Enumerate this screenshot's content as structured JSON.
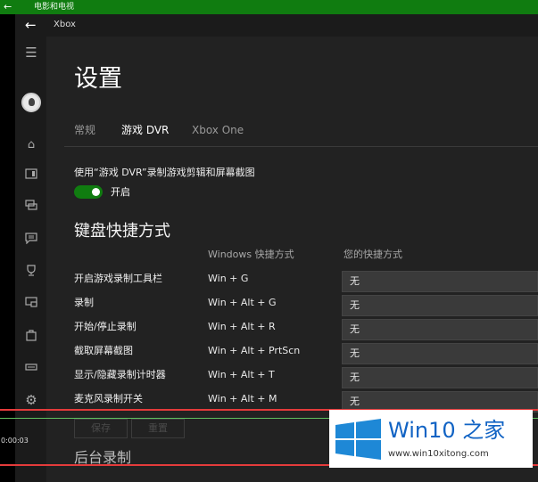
{
  "outer_window": {
    "title": "电影和电视"
  },
  "app": {
    "title": "Xbox"
  },
  "page": {
    "title": "设置"
  },
  "tabs": [
    {
      "label": "常规"
    },
    {
      "label": "游戏 DVR"
    },
    {
      "label": "Xbox One"
    }
  ],
  "active_tab": "游戏 DVR",
  "dvr": {
    "label": "使用“游戏 DVR”录制游戏剪辑和屏幕截图",
    "toggle_state": "开启",
    "toggle_on": true
  },
  "shortcuts": {
    "heading": "键盘快捷方式",
    "col_windows": "Windows 快捷方式",
    "col_yours": "您的快捷方式",
    "rows": [
      {
        "label": "开启游戏录制工具栏",
        "windows": "Win + G",
        "yours": "无"
      },
      {
        "label": "录制",
        "windows": "Win + Alt + G",
        "yours": "无"
      },
      {
        "label": "开始/停止录制",
        "windows": "Win + Alt + R",
        "yours": "无"
      },
      {
        "label": "截取屏幕截图",
        "windows": "Win + Alt + PrtScn",
        "yours": "无"
      },
      {
        "label": "显示/隐藏录制计时器",
        "windows": "Win + Alt + T",
        "yours": "无"
      },
      {
        "label": "麦克风录制开关",
        "windows": "Win + Alt + M",
        "yours": "无"
      }
    ],
    "save_label": "保存",
    "reset_label": "重置"
  },
  "background_recording": {
    "heading": "后台录制"
  },
  "player": {
    "timecode": "0:00:03"
  },
  "watermark": {
    "name": "Win10 之家",
    "url": "www.win10xitong.com"
  },
  "colors": {
    "accent_green": "#107c10",
    "app_bg": "#222222",
    "player_line": "#e43b3b"
  },
  "icons": {
    "outer_back": "back-arrow-icon",
    "app_back": "back-arrow-icon",
    "menu": "hamburger-icon",
    "nav": [
      "home-icon",
      "my-games-icon",
      "achievements-icon",
      "messages-icon",
      "trophy-icon",
      "game-dvr-icon",
      "store-icon",
      "connect-icon",
      "settings-icon"
    ]
  }
}
